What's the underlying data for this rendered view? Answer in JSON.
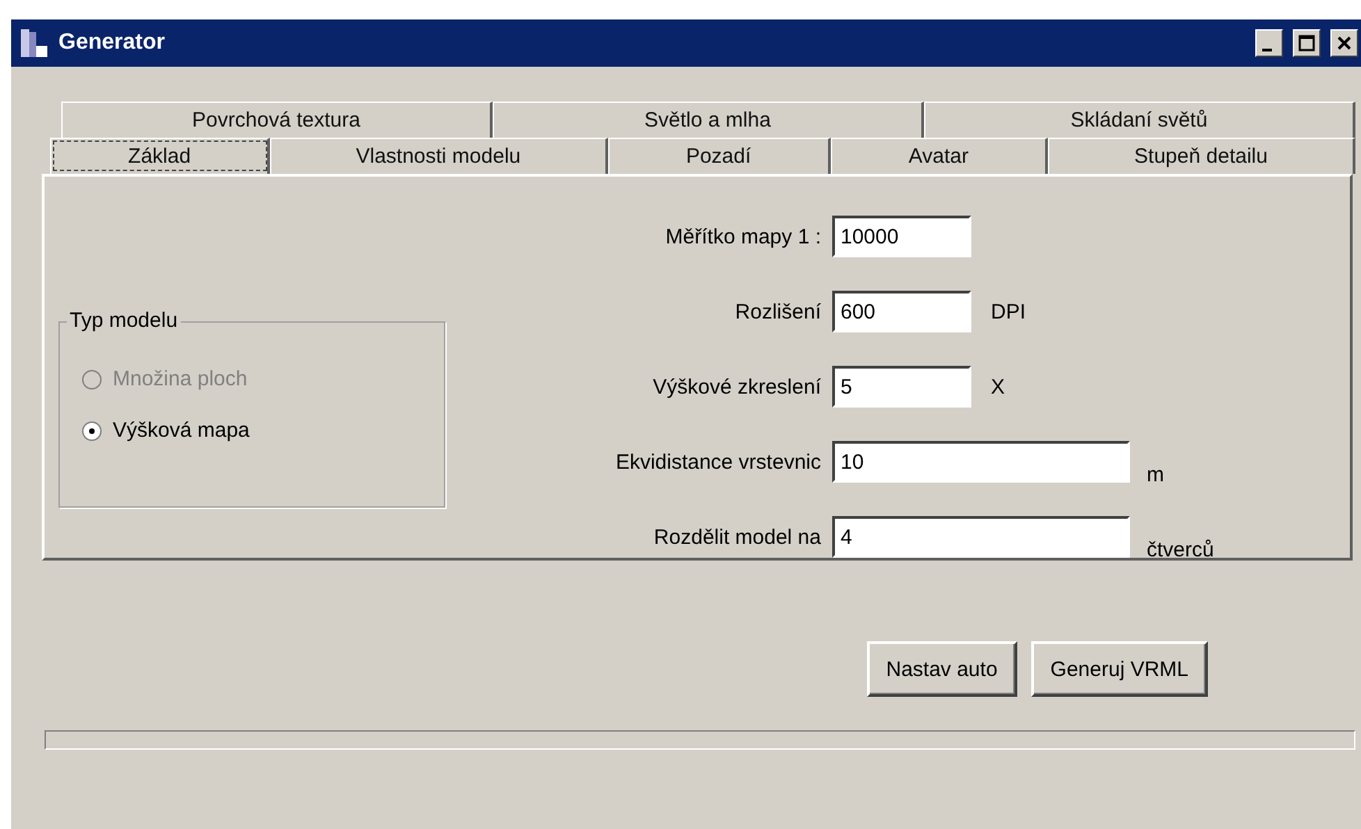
{
  "window": {
    "title": "Generator"
  },
  "tab_rows": [
    {
      "tabs": [
        {
          "label": "Povrchová textura",
          "selected": false
        },
        {
          "label": "Světlo a mlha",
          "selected": false
        },
        {
          "label": "Skládaní světů",
          "selected": false
        }
      ]
    },
    {
      "tabs": [
        {
          "label": "Základ",
          "selected": true
        },
        {
          "label": "Vlastnosti modelu",
          "selected": false
        },
        {
          "label": "Pozadí",
          "selected": false
        },
        {
          "label": "Avatar",
          "selected": false
        },
        {
          "label": "Stupeň detailu",
          "selected": false
        }
      ]
    }
  ],
  "model_type": {
    "title": "Typ modelu",
    "options": [
      {
        "label": "Množina ploch",
        "selected": false,
        "disabled": true
      },
      {
        "label": "Výšková mapa",
        "selected": true,
        "disabled": false
      }
    ]
  },
  "fields": [
    {
      "label": "Měřítko mapy 1 :",
      "value": "10000"
    },
    {
      "label": "Rozlišení",
      "value": "600",
      "unit": "DPI"
    },
    {
      "label": "Výškové zkreslení",
      "value": "5",
      "unit": "X"
    },
    {
      "label": "Ekvidistance vrstevnic",
      "value": "10",
      "unit": "m"
    },
    {
      "label": "Rozdělit model na",
      "value": "4",
      "unit": "čtverců"
    }
  ],
  "buttons": [
    "Nastav auto",
    "Generuj VRML"
  ]
}
